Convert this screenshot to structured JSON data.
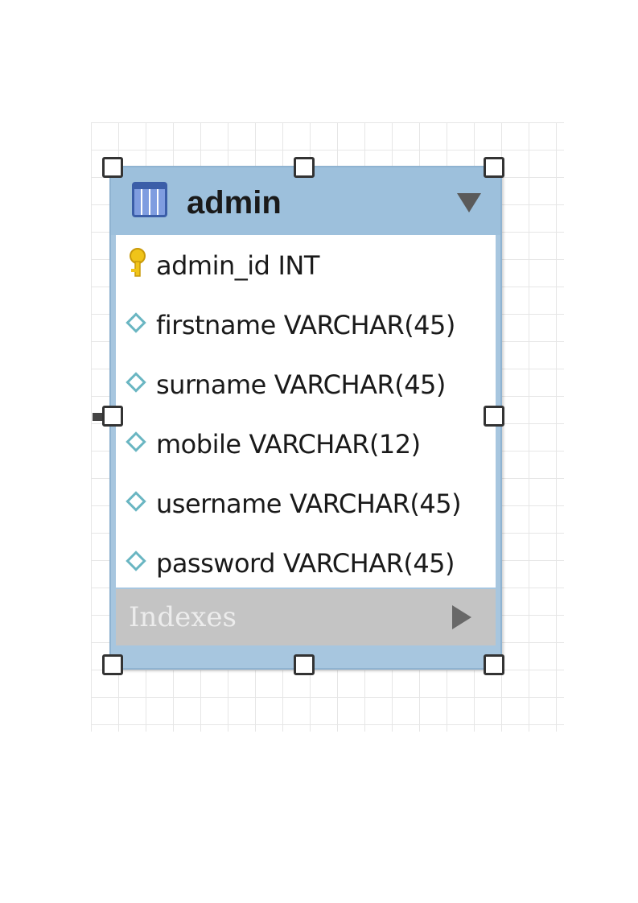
{
  "table": {
    "name": "admin",
    "columns": [
      {
        "name": "admin_id",
        "type": "INT",
        "icon": "primary-key-icon"
      },
      {
        "name": "firstname",
        "type": "VARCHAR(45)",
        "icon": "column-diamond-icon"
      },
      {
        "name": "surname",
        "type": "VARCHAR(45)",
        "icon": "column-diamond-icon"
      },
      {
        "name": "mobile",
        "type": "VARCHAR(12)",
        "icon": "column-diamond-icon"
      },
      {
        "name": "username",
        "type": "VARCHAR(45)",
        "icon": "column-diamond-icon"
      },
      {
        "name": "password",
        "type": "VARCHAR(45)",
        "icon": "column-diamond-icon"
      }
    ],
    "indexes_label": "Indexes"
  },
  "colors": {
    "header": "#9dc0dc",
    "indexes_bg": "#c4c4c4",
    "diamond": "#6ab6c2",
    "key": "#f0c419"
  }
}
